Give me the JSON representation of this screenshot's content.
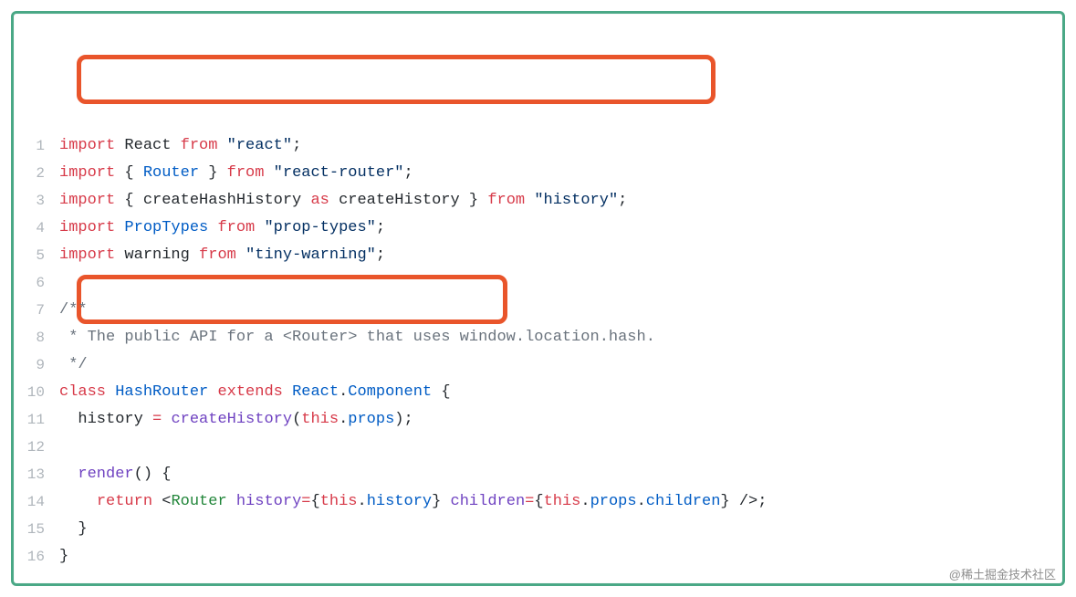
{
  "watermark": "@稀土掘金技术社区",
  "lines": [
    {
      "n": "1",
      "tokens": [
        [
          "kw",
          "import"
        ],
        [
          "plain",
          " React "
        ],
        [
          "kw",
          "from"
        ],
        [
          "plain",
          " "
        ],
        [
          "str",
          "\"react\""
        ],
        [
          "plain",
          ";"
        ]
      ]
    },
    {
      "n": "2",
      "tokens": [
        [
          "kw",
          "import"
        ],
        [
          "plain",
          " { "
        ],
        [
          "def",
          "Router"
        ],
        [
          "plain",
          " } "
        ],
        [
          "kw",
          "from"
        ],
        [
          "plain",
          " "
        ],
        [
          "str",
          "\"react-router\""
        ],
        [
          "plain",
          ";"
        ]
      ]
    },
    {
      "n": "3",
      "tokens": [
        [
          "kw",
          "import"
        ],
        [
          "plain",
          " { createHashHistory "
        ],
        [
          "kw",
          "as"
        ],
        [
          "plain",
          " createHistory } "
        ],
        [
          "kw",
          "from"
        ],
        [
          "plain",
          " "
        ],
        [
          "str",
          "\"history\""
        ],
        [
          "plain",
          ";"
        ]
      ]
    },
    {
      "n": "4",
      "tokens": [
        [
          "kw",
          "import"
        ],
        [
          "plain",
          " "
        ],
        [
          "def",
          "PropTypes"
        ],
        [
          "plain",
          " "
        ],
        [
          "kw",
          "from"
        ],
        [
          "plain",
          " "
        ],
        [
          "str",
          "\"prop-types\""
        ],
        [
          "plain",
          ";"
        ]
      ]
    },
    {
      "n": "5",
      "tokens": [
        [
          "kw",
          "import"
        ],
        [
          "plain",
          " warning "
        ],
        [
          "kw",
          "from"
        ],
        [
          "plain",
          " "
        ],
        [
          "str",
          "\"tiny-warning\""
        ],
        [
          "plain",
          ";"
        ]
      ]
    },
    {
      "n": "6",
      "tokens": []
    },
    {
      "n": "7",
      "tokens": [
        [
          "cmt",
          "/**"
        ]
      ]
    },
    {
      "n": "8",
      "tokens": [
        [
          "cmt",
          " * The public API for a <Router> that uses window.location.hash."
        ]
      ]
    },
    {
      "n": "9",
      "tokens": [
        [
          "cmt",
          " */"
        ]
      ]
    },
    {
      "n": "10",
      "tokens": [
        [
          "kw",
          "class"
        ],
        [
          "plain",
          " "
        ],
        [
          "def",
          "HashRouter"
        ],
        [
          "plain",
          " "
        ],
        [
          "kw",
          "extends"
        ],
        [
          "plain",
          " "
        ],
        [
          "def",
          "React"
        ],
        [
          "plain",
          "."
        ],
        [
          "def",
          "Component"
        ],
        [
          "plain",
          " {"
        ]
      ]
    },
    {
      "n": "11",
      "tokens": [
        [
          "plain",
          "  history "
        ],
        [
          "op",
          "="
        ],
        [
          "plain",
          " "
        ],
        [
          "fn",
          "createHistory"
        ],
        [
          "plain",
          "("
        ],
        [
          "kw",
          "this"
        ],
        [
          "plain",
          "."
        ],
        [
          "def",
          "props"
        ],
        [
          "plain",
          ");"
        ]
      ]
    },
    {
      "n": "12",
      "tokens": []
    },
    {
      "n": "13",
      "tokens": [
        [
          "plain",
          "  "
        ],
        [
          "fn",
          "render"
        ],
        [
          "plain",
          "() {"
        ]
      ]
    },
    {
      "n": "14",
      "tokens": [
        [
          "plain",
          "    "
        ],
        [
          "kw",
          "return"
        ],
        [
          "plain",
          " <"
        ],
        [
          "jsx",
          "Router"
        ],
        [
          "plain",
          " "
        ],
        [
          "attr",
          "history"
        ],
        [
          "op",
          "="
        ],
        [
          "plain",
          "{"
        ],
        [
          "kw",
          "this"
        ],
        [
          "plain",
          "."
        ],
        [
          "def",
          "history"
        ],
        [
          "plain",
          "} "
        ],
        [
          "attr",
          "children"
        ],
        [
          "op",
          "="
        ],
        [
          "plain",
          "{"
        ],
        [
          "kw",
          "this"
        ],
        [
          "plain",
          "."
        ],
        [
          "def",
          "props"
        ],
        [
          "plain",
          "."
        ],
        [
          "def",
          "children"
        ],
        [
          "plain",
          "} />;"
        ]
      ]
    },
    {
      "n": "15",
      "tokens": [
        [
          "plain",
          "  }"
        ]
      ]
    },
    {
      "n": "16",
      "tokens": [
        [
          "plain",
          "}"
        ]
      ]
    }
  ]
}
